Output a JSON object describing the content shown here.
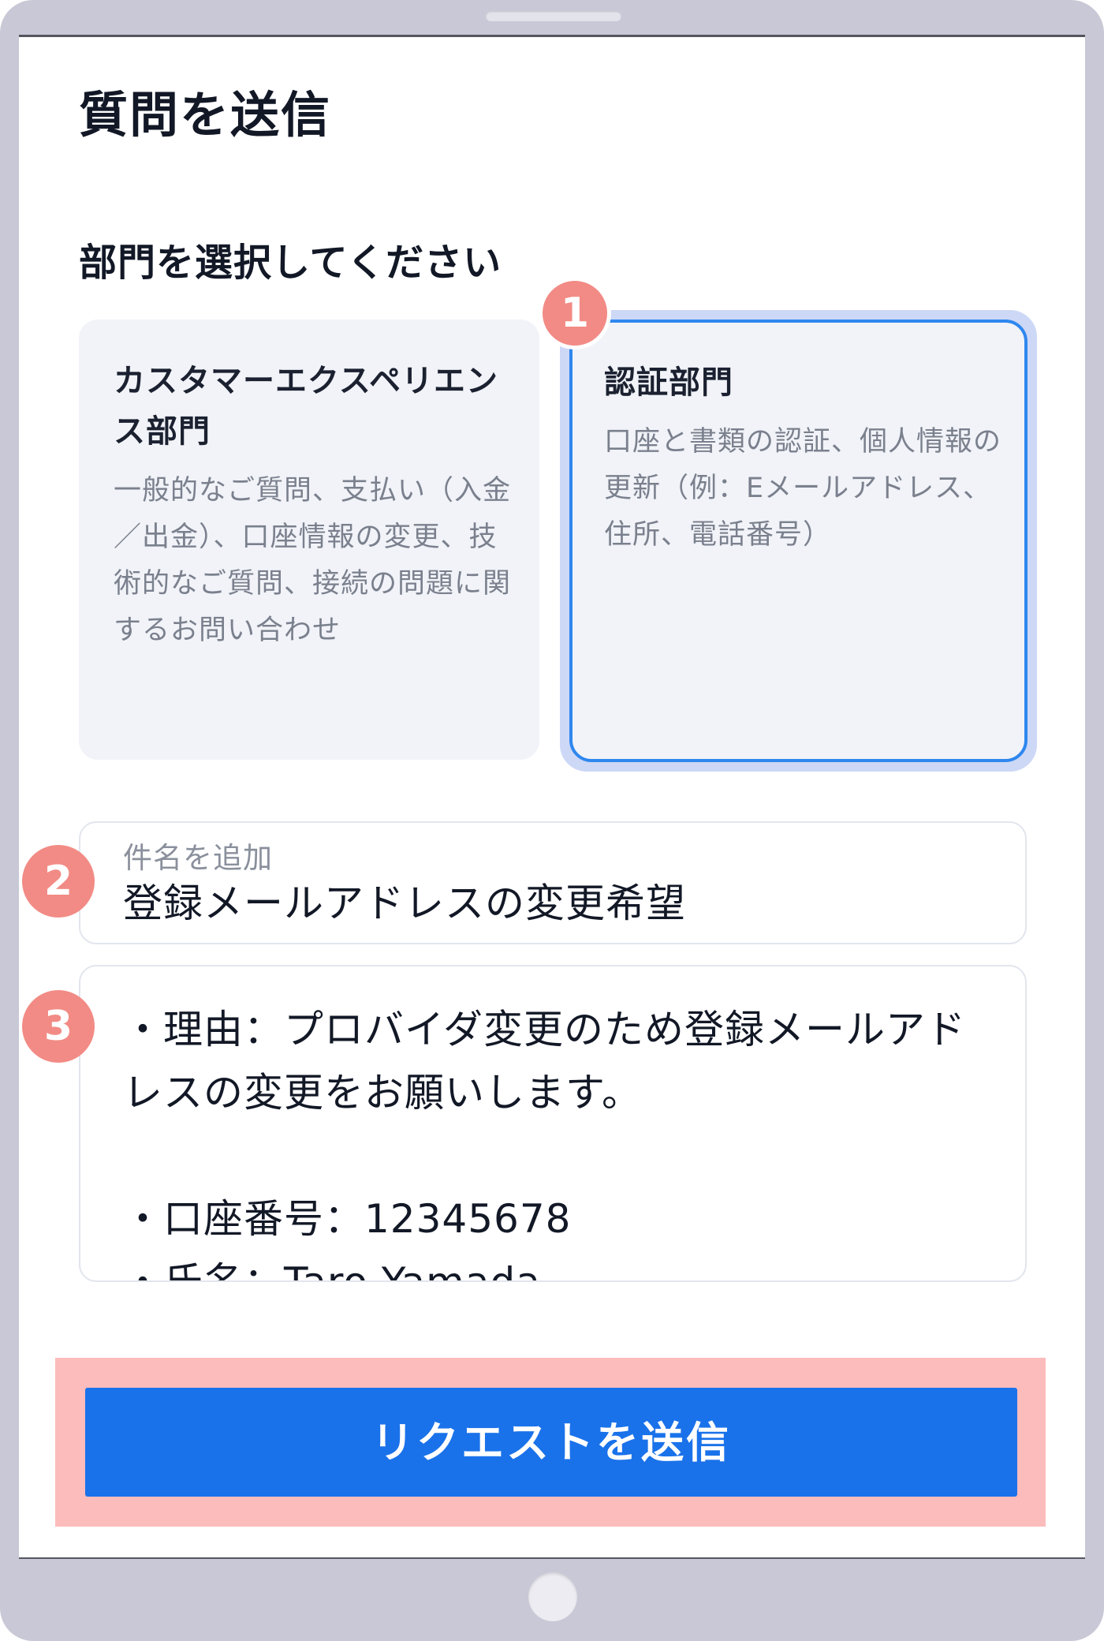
{
  "page": {
    "title": "質問を送信",
    "section_title": "部門を選択してください"
  },
  "departments": [
    {
      "title": "カスタマーエクスペリエンス部門",
      "description": "一般的なご質問、支払い（入金／出金）、口座情報の変更、技術的なご質問、接続の問題に関するお問い合わせ",
      "selected": false
    },
    {
      "title": "認証部門",
      "description": "口座と書類の認証、個人情報の更新（例：Eメールアドレス、住所、電話番号）",
      "selected": true
    }
  ],
  "subject": {
    "label": "件名を追加",
    "value": "登録メールアドレスの変更希望"
  },
  "message": {
    "value": "・理由：プロバイダ変更のため登録メールアドレスの変更をお願いします。\n\n・口座番号：12345678\n・氏名：Taro Yamada"
  },
  "submit": {
    "label": "リクエストを送信"
  },
  "badges": [
    "1",
    "2",
    "3"
  ],
  "colors": {
    "accent": "#1a72ea",
    "selected_border": "#2f87ee",
    "badge": "#f28b85",
    "highlight": "#fcbcbc"
  }
}
